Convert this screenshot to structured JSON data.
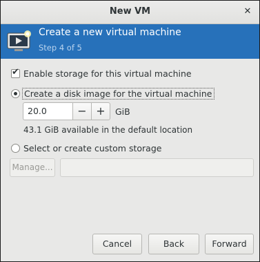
{
  "window": {
    "title": "New VM",
    "close_glyph": "✕"
  },
  "banner": {
    "icon": "vm-monitor-icon",
    "title": "Create a new virtual machine",
    "step": "Step 4 of 5",
    "color": "#2771ba"
  },
  "storage": {
    "enable_label": "Enable storage for this virtual machine",
    "enable_checked": true,
    "disk_image_label": "Create a disk image for the virtual machine",
    "disk_image_selected": true,
    "size_value": "20.0",
    "decrement_label": "−",
    "increment_label": "+",
    "unit": "GiB",
    "available_text": "43.1 GiB available in the default location",
    "custom_label": "Select or create custom storage",
    "custom_selected": false,
    "manage_label": "Manage...",
    "path_value": ""
  },
  "footer": {
    "cancel_label": "Cancel",
    "back_label": "Back",
    "forward_label": "Forward"
  }
}
